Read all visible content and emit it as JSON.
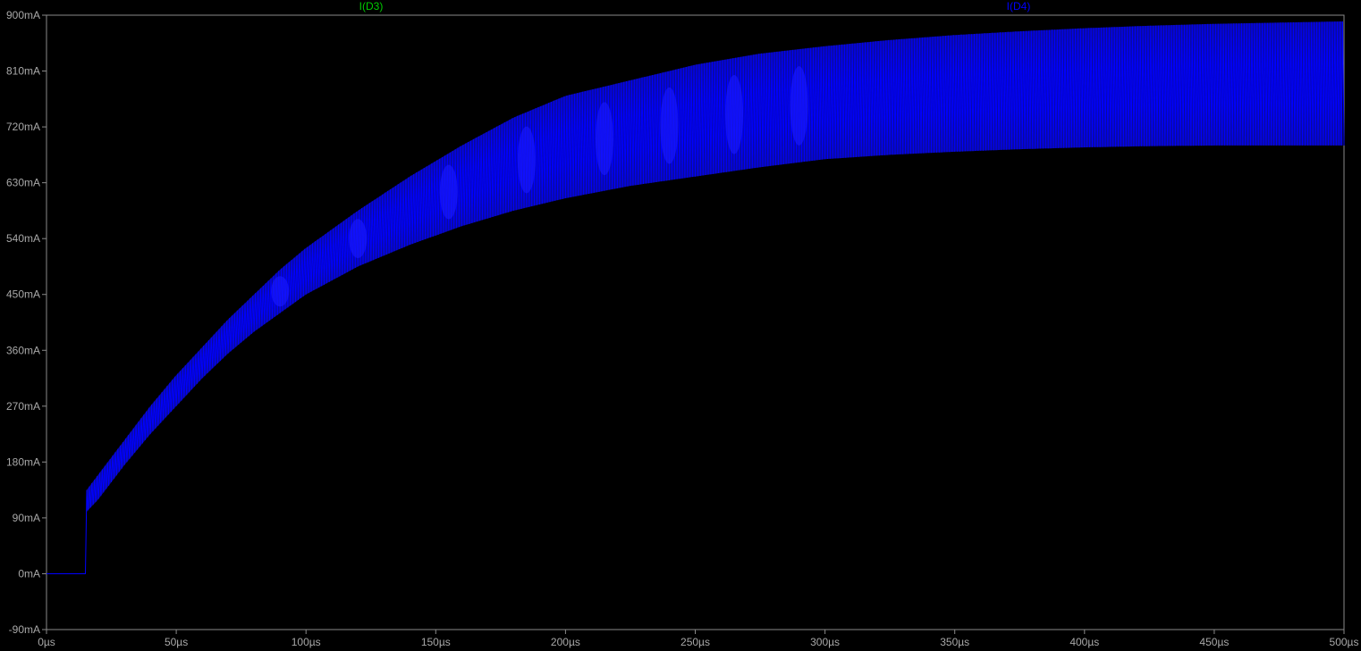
{
  "chart_data": {
    "type": "line",
    "title": "",
    "xlabel": "",
    "ylabel": "",
    "xlim": [
      0,
      500
    ],
    "ylim": [
      -90,
      900
    ],
    "x_ticks": [
      0,
      50,
      100,
      150,
      200,
      250,
      300,
      350,
      400,
      450,
      500
    ],
    "x_tick_labels": [
      "0µs",
      "50µs",
      "100µs",
      "150µs",
      "200µs",
      "250µs",
      "300µs",
      "350µs",
      "400µs",
      "450µs",
      "500µs"
    ],
    "y_ticks": [
      -90,
      0,
      90,
      180,
      270,
      360,
      450,
      540,
      630,
      720,
      810,
      900
    ],
    "y_tick_labels": [
      "-90mA",
      "0mA",
      "90mA",
      "180mA",
      "270mA",
      "360mA",
      "450mA",
      "540mA",
      "630mA",
      "720mA",
      "810mA",
      "900mA"
    ],
    "grid": false,
    "legend_placement": "top",
    "series": [
      {
        "name": "I(D3)",
        "color": "#00cc00",
        "x": [],
        "y": []
      },
      {
        "name": "I(D4)",
        "color": "#0000ff",
        "envelope": {
          "x": [
            0,
            15,
            15.5,
            20,
            30,
            40,
            50,
            60,
            70,
            80,
            90,
            100,
            120,
            140,
            160,
            180,
            200,
            225,
            250,
            275,
            300,
            325,
            350,
            375,
            400,
            425,
            450,
            475,
            500
          ],
          "upper": [
            0,
            0,
            135,
            160,
            215,
            270,
            320,
            365,
            410,
            450,
            490,
            525,
            585,
            640,
            690,
            735,
            770,
            795,
            820,
            838,
            850,
            860,
            868,
            874,
            879,
            883,
            886,
            888,
            890
          ],
          "lower": [
            0,
            0,
            100,
            120,
            175,
            225,
            270,
            315,
            355,
            390,
            420,
            450,
            495,
            530,
            560,
            585,
            605,
            625,
            640,
            655,
            668,
            675,
            680,
            684,
            687,
            689,
            690,
            690,
            690
          ]
        }
      }
    ]
  }
}
